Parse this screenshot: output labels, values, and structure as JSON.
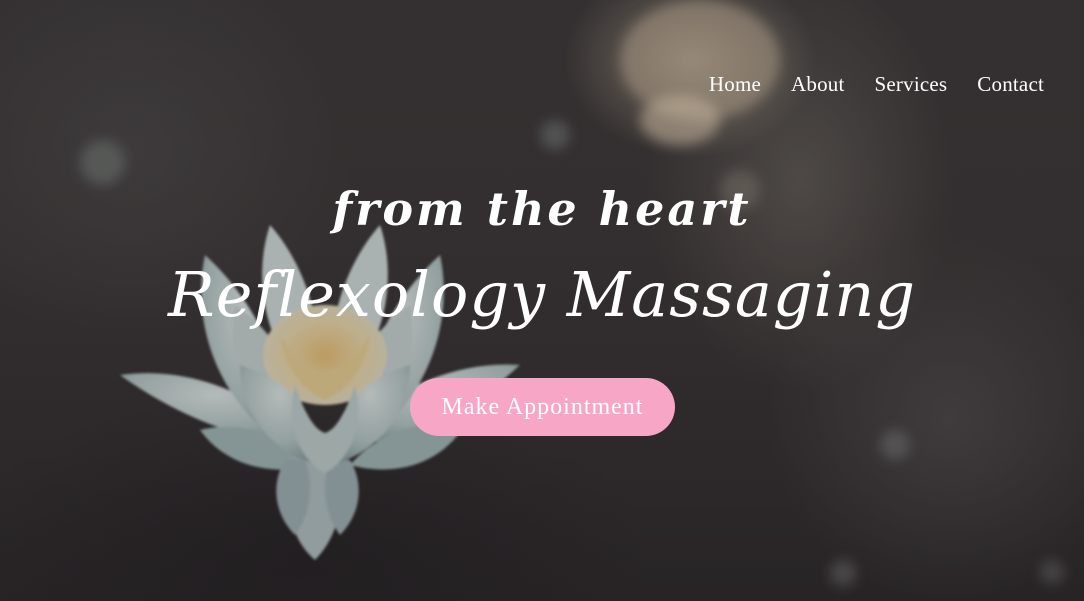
{
  "nav": {
    "items": [
      {
        "label": "Home"
      },
      {
        "label": "About"
      },
      {
        "label": "Services"
      },
      {
        "label": "Contact"
      }
    ]
  },
  "hero": {
    "tagline": "from the heart",
    "headline": "Reflexology Massaging",
    "cta_label": "Make Appointment",
    "background_image": "lotus-flower-photo"
  },
  "colors": {
    "cta_background": "#f7a6c6",
    "text": "#ffffff",
    "background": "#2f2c2d"
  }
}
